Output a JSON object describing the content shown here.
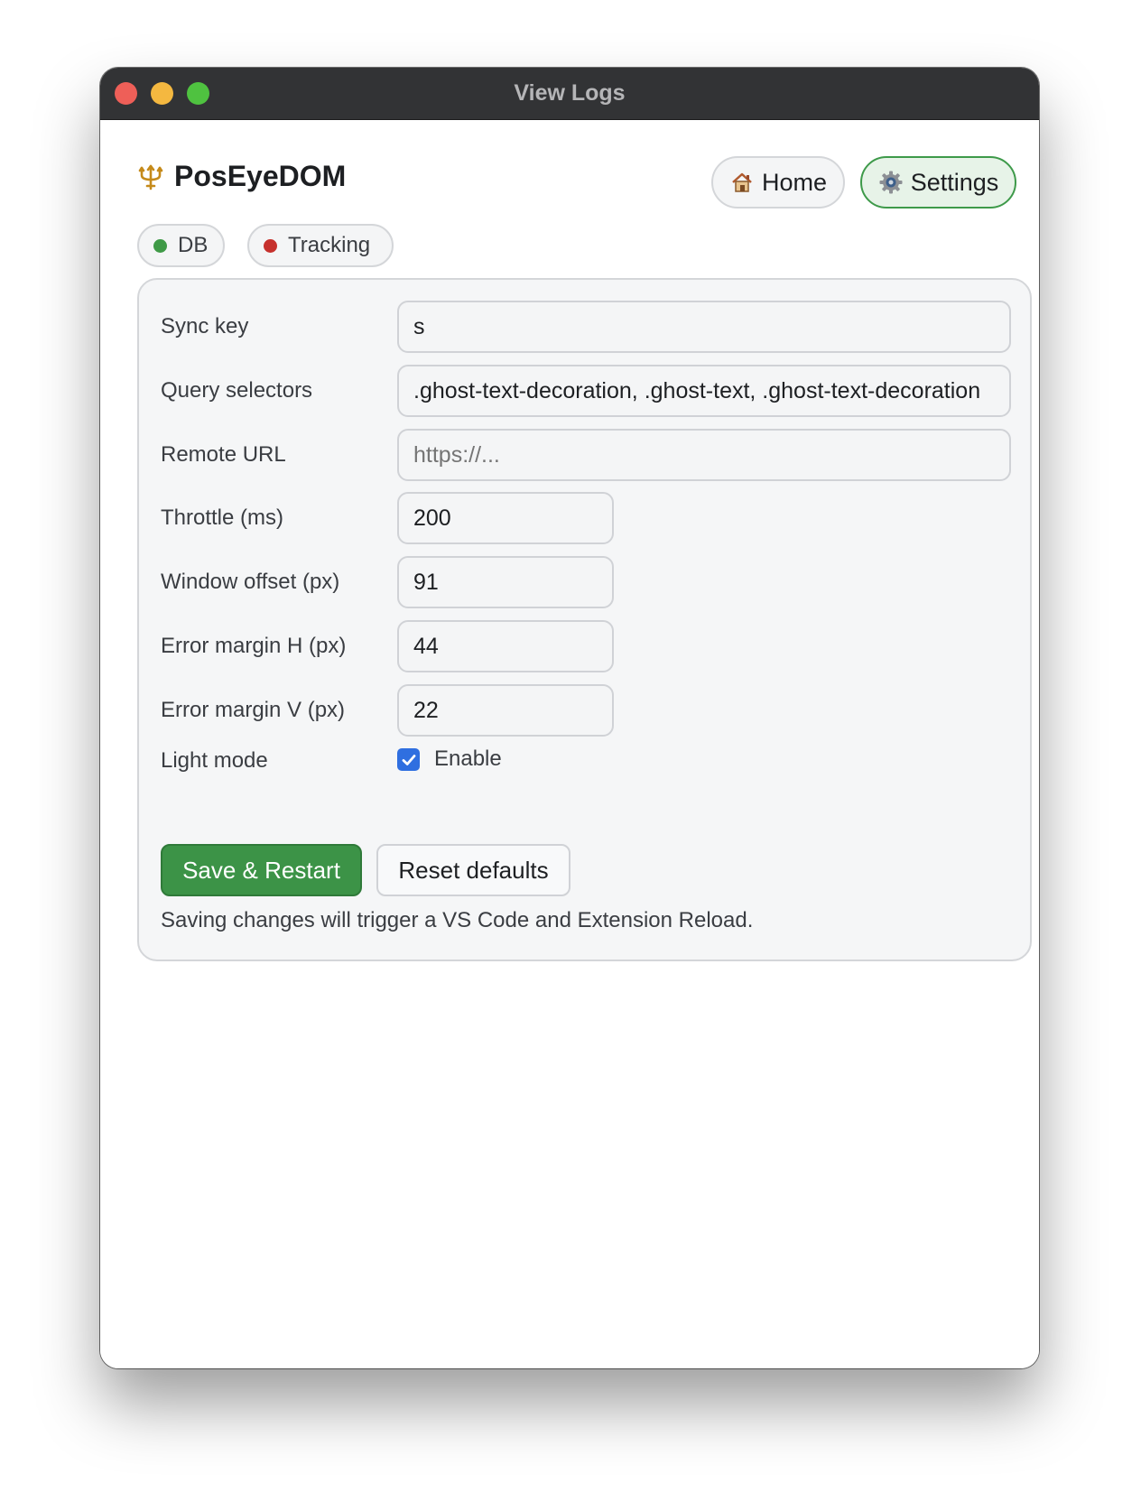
{
  "window": {
    "title": "View Logs"
  },
  "header": {
    "app_name": "PosEyeDOM",
    "app_icon": "trident-icon",
    "nav": [
      {
        "label": "Home",
        "icon": "house-icon",
        "active": false
      },
      {
        "label": "Settings",
        "icon": "gear-icon",
        "active": true
      }
    ]
  },
  "status": {
    "items": [
      {
        "label": "DB",
        "state": "ok",
        "color": "#3f9a47"
      },
      {
        "label": "Tracking",
        "state": "error",
        "color": "#c6312d"
      }
    ]
  },
  "settings": {
    "fields": [
      {
        "label": "Sync key",
        "value": "s"
      },
      {
        "label": "Query selectors",
        "value": ".ghost-text-decoration, .ghost-text, .ghost-text-decoration"
      },
      {
        "label": "Remote URL",
        "value": "",
        "placeholder": "https://..."
      },
      {
        "label": "Throttle (ms)",
        "value": "200"
      },
      {
        "label": "Window offset (px)",
        "value": "91"
      },
      {
        "label": "Error margin H (px)",
        "value": "44"
      },
      {
        "label": "Error margin V (px)",
        "value": "22"
      }
    ],
    "light_mode": {
      "label": "Light mode",
      "checkbox_label": "Enable",
      "checked": true
    },
    "save_label": "Save & Restart",
    "reset_label": "Reset defaults",
    "note": "Saving changes will trigger a VS Code and Extension Reload."
  },
  "colors": {
    "accent_green": "#3c9347",
    "checkbox_blue": "#2f6fe0",
    "titlebar": "#323335"
  }
}
